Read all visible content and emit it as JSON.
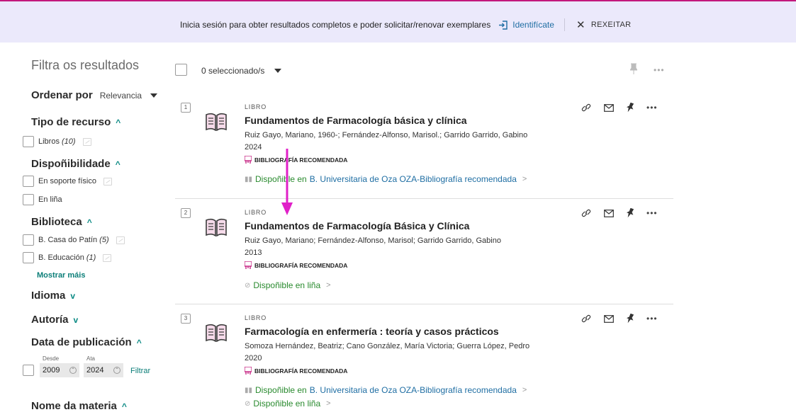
{
  "banner": {
    "message": "Inicia sesión para obter resultados completos e poder solicitar/renovar exemplares",
    "signin_label": "Identifícate",
    "dismiss_label": "REXEITAR",
    "background_color": "#ebe9fb",
    "accent_color": "#c2187c"
  },
  "filters": {
    "title": "Filtra os resultados",
    "sort": {
      "label": "Ordenar por",
      "value": "Relevancia"
    },
    "resource_type": {
      "heading": "Tipo de recurso",
      "options": [
        {
          "label": "Libros",
          "count": "(10)"
        }
      ]
    },
    "availability": {
      "heading": "Dispoñibilidade",
      "options": [
        {
          "label": "En soporte físico"
        },
        {
          "label": "En liña"
        }
      ]
    },
    "library": {
      "heading": "Biblioteca",
      "options": [
        {
          "label": "B. Casa do Patín",
          "count": "(5)"
        },
        {
          "label": "B. Educación",
          "count": "(1)"
        }
      ],
      "more_label": "Mostrar máis"
    },
    "language": {
      "heading": "Idioma"
    },
    "authorship": {
      "heading": "Autoría"
    },
    "pub_date": {
      "heading": "Data de publicación",
      "from_label": "Desde",
      "from_value": "2009",
      "to_label": "Ata",
      "to_value": "2024",
      "apply_label": "Filtrar"
    },
    "subject": {
      "heading": "Nome da materia"
    }
  },
  "results_header": {
    "selected_label": "0 seleccionado/s"
  },
  "results": [
    {
      "index": "1",
      "type": "LIBRO",
      "title": "Fundamentos de Farmacología básica y clínica",
      "authors": "Ruiz Gayo, Mariano, 1960-; Fernández-Alfonso, Marisol.; Garrido Garrido, Gabino",
      "year": "2024",
      "badge": "BIBLIOGRAFÍA RECOMENDADA",
      "physical": {
        "text": "Dispoñible en",
        "location": "B. Universitaria de Oza  OZA-Bibliografía recomendada"
      }
    },
    {
      "index": "2",
      "type": "LIBRO",
      "title": "Fundamentos de Farmacología Básica y Clínica",
      "authors": "Ruiz Gayo, Mariano; Fernández-Alfonso, Marisol; Garrido Garrido, Gabino",
      "year": "2013",
      "badge": "BIBLIOGRAFÍA RECOMENDADA",
      "online": {
        "text": "Dispoñible en liña"
      }
    },
    {
      "index": "3",
      "type": "LIBRO",
      "title": "Farmacología en enfermería : teoría y casos prácticos",
      "authors": "Somoza Hernández, Beatriz; Cano González, María Victoria; Guerra López, Pedro",
      "year": "2020",
      "badge": "BIBLIOGRAFÍA RECOMENDADA",
      "physical": {
        "text": "Dispoñible en",
        "location": "B. Universitaria de Oza  OZA-Bibliografía recomendada"
      },
      "online": {
        "text": "Dispoñible en liña"
      }
    }
  ],
  "icons": {
    "signin": "sign-in-icon",
    "book": "book-icon",
    "link": "link-icon",
    "email": "email-icon",
    "pin": "pin-icon",
    "more": "more-icon",
    "badge": "reading-list-icon"
  },
  "annotation": {
    "color": "#e020c8"
  }
}
